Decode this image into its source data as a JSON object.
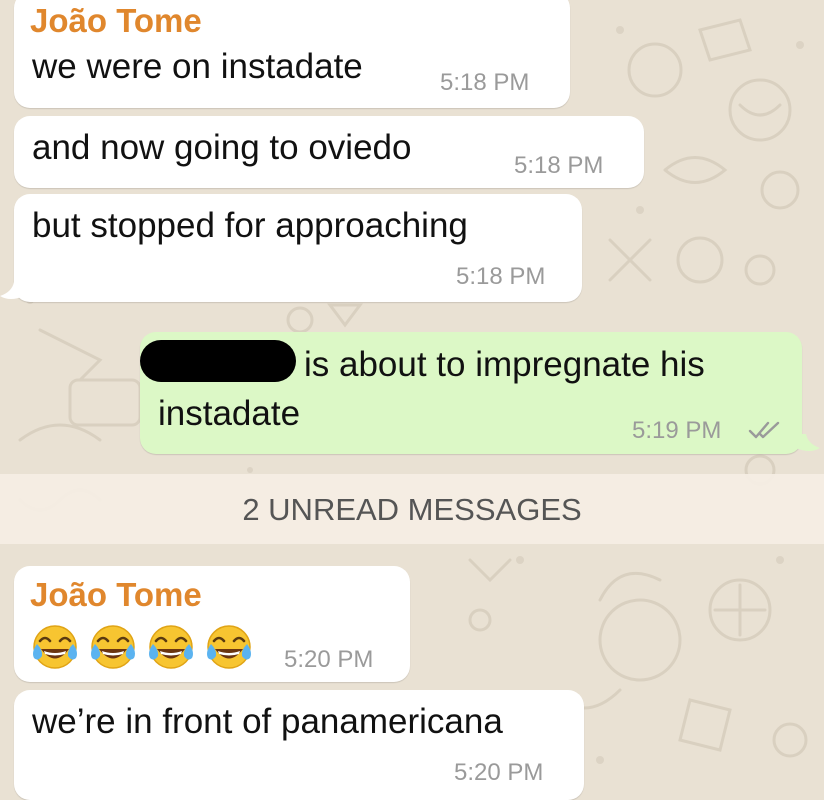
{
  "colors": {
    "background": "#e9e1d3",
    "incoming_bubble": "#ffffff",
    "outgoing_bubble": "#dcf8c6",
    "sender_name": "#e0872d",
    "timestamp": "#9a9a9a",
    "read_ticks": "#9a9a9a"
  },
  "messages": [
    {
      "sender": "João Tome",
      "text": "we were on instadate",
      "time": "5:18 PM",
      "direction": "incoming"
    },
    {
      "text": "and now going to oviedo",
      "time": "5:18 PM",
      "direction": "incoming"
    },
    {
      "text": "but stopped for approaching",
      "time": "5:18 PM",
      "direction": "incoming"
    },
    {
      "text_line1": "is about to impregnate his",
      "text_line2": "instadate",
      "time": "5:19 PM",
      "direction": "outgoing",
      "status": "read",
      "status_icon": "double-check-icon",
      "redacted_name": true
    },
    {
      "sender": "João Tome",
      "emoji": [
        "😂",
        "😂",
        "😂",
        "😂"
      ],
      "emoji_icon": "face-with-tears-of-joy-icon",
      "time": "5:20 PM",
      "direction": "incoming"
    },
    {
      "text": "we’re in front of panamericana",
      "time": "5:20 PM",
      "direction": "incoming"
    }
  ],
  "unread_divider": "2 UNREAD MESSAGES"
}
